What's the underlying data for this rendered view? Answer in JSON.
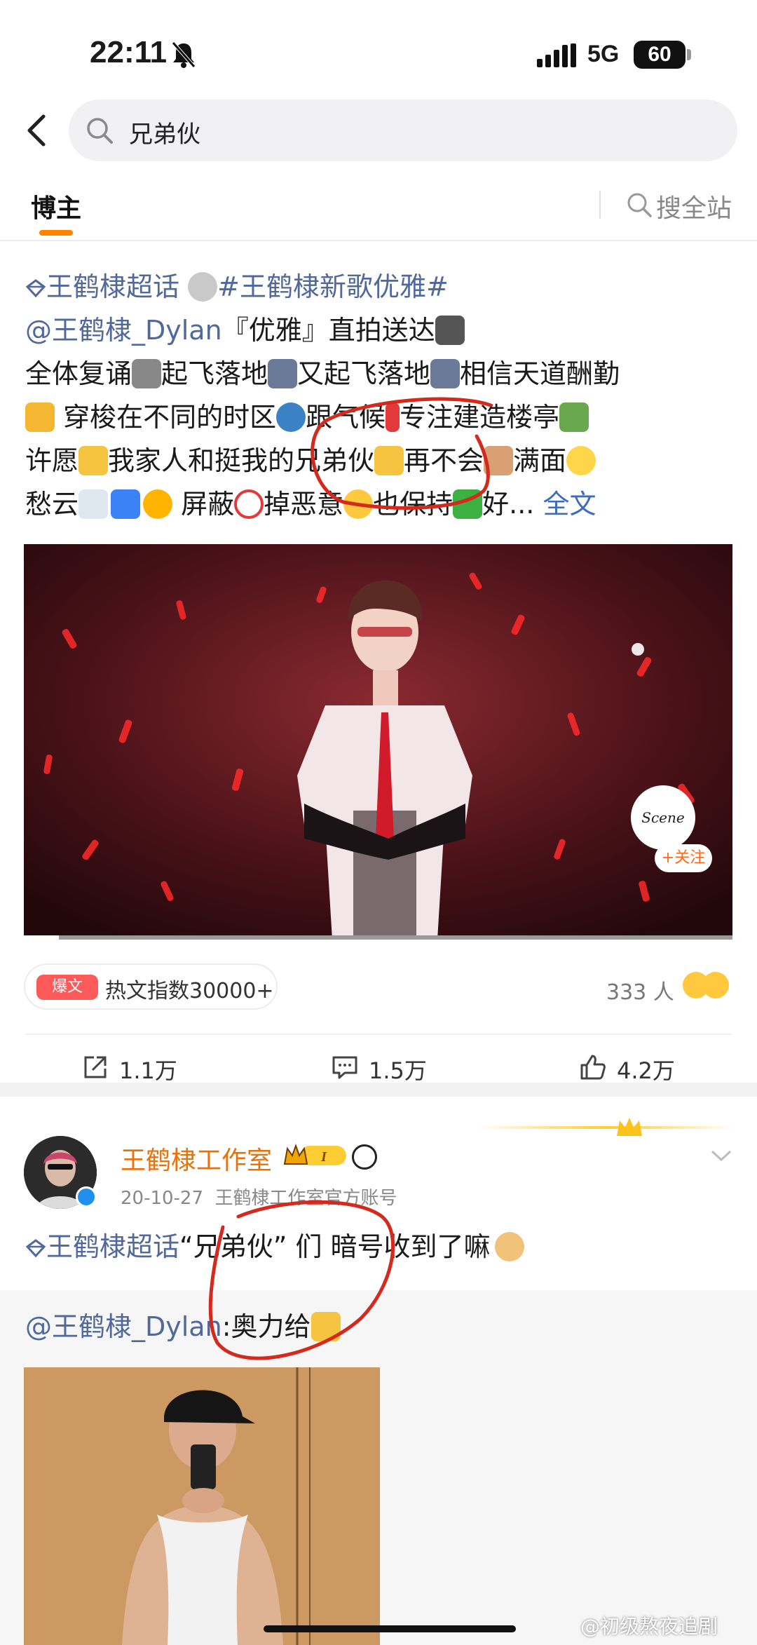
{
  "status_bar": {
    "time": "22:11",
    "network": "5G",
    "battery": "60"
  },
  "search": {
    "query": "兄弟伙"
  },
  "tabs": {
    "active": "博主",
    "search_all": "搜全站"
  },
  "post1": {
    "line1_topic": "王鹤棣超话",
    "line1_hashtag": "#王鹤棣新歌优雅#",
    "line2_mention": "@王鹤棣_Dylan",
    "line2_text": "『优雅』直拍送达",
    "line3_a": "全体复诵",
    "line3_b": "起飞落地",
    "line3_c": "又起飞落地",
    "line3_d": "相信天道酬勤",
    "line4_a": " 穿梭在不同的时区",
    "line4_b": "跟气候",
    "line4_c": "专注建造楼亭",
    "line5_a": "许愿",
    "line5_b": "我家人和挺我的兄弟伙",
    "line5_c": "再不会",
    "line5_d": "满面",
    "line6_a": "愁云",
    "line6_b": " 屏蔽",
    "line6_c": "掉恶意",
    "line6_d": "也保持",
    "line6_e": "好...",
    "more": "全文",
    "video_logo": "Scene",
    "follow": "+关注",
    "hot_badge": "爆文",
    "hot_index": "热文指数30000+",
    "viewers": "333 人",
    "share_count": "1.1万",
    "comment_count": "1.5万",
    "like_count": "4.2万"
  },
  "post2": {
    "author": "王鹤棣工作室",
    "vip_level": "I",
    "date": "20-10-27",
    "source": "王鹤棣工作室官方账号",
    "topic": "王鹤棣超话",
    "text": "“兄弟伙” 们 暗号收到了嘛",
    "repost_mention": "@王鹤棣_Dylan",
    "repost_text": ":奥力给"
  },
  "watermark": "@初级熬夜追剧",
  "colors": {
    "accent": "#ff8200",
    "link": "#50699a",
    "author": "#e8710a",
    "hot": "#ff5a5a",
    "annotation": "#d42a1e"
  }
}
